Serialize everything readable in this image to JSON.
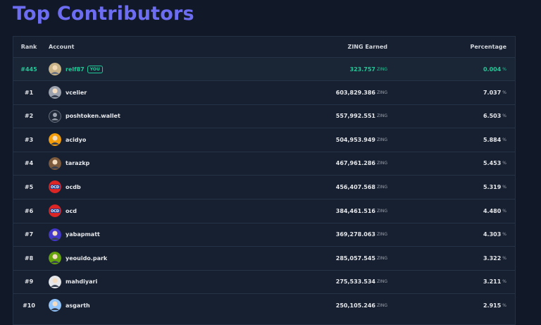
{
  "page": {
    "title": "Top Contributors"
  },
  "table": {
    "headers": {
      "rank": "Rank",
      "account": "Account",
      "zing": "ZING Earned",
      "percentage": "Percentage"
    },
    "unit_label": "ZING",
    "percent_symbol": "%",
    "you_row": {
      "rank": "#445",
      "account": "relf87",
      "badge": "YOU",
      "zing": "323.757",
      "percentage": "0.004",
      "avatar": "user-avatar-icon"
    },
    "rows": [
      {
        "rank": "#1",
        "account": "vcelier",
        "zing": "603,829.386",
        "percentage": "7.037",
        "avatar": "user-avatar-icon"
      },
      {
        "rank": "#2",
        "account": "poshtoken.wallet",
        "zing": "557,992.551",
        "percentage": "6.503",
        "avatar": "default-user-icon"
      },
      {
        "rank": "#3",
        "account": "acidyo",
        "zing": "504,953.949",
        "percentage": "5.884",
        "avatar": "user-avatar-icon"
      },
      {
        "rank": "#4",
        "account": "tarazkp",
        "zing": "467,961.286",
        "percentage": "5.453",
        "avatar": "user-avatar-icon"
      },
      {
        "rank": "#5",
        "account": "ocdb",
        "zing": "456,407.568",
        "percentage": "5.319",
        "avatar": "ocd-logo-icon"
      },
      {
        "rank": "#6",
        "account": "ocd",
        "zing": "384,461.516",
        "percentage": "4.480",
        "avatar": "ocd-logo-icon"
      },
      {
        "rank": "#7",
        "account": "yabapmatt",
        "zing": "369,278.063",
        "percentage": "4.303",
        "avatar": "user-avatar-icon"
      },
      {
        "rank": "#8",
        "account": "yeouido.park",
        "zing": "285,057.545",
        "percentage": "3.322",
        "avatar": "user-avatar-icon"
      },
      {
        "rank": "#9",
        "account": "mahdiyari",
        "zing": "275,533.534",
        "percentage": "3.211",
        "avatar": "user-avatar-icon"
      },
      {
        "rank": "#10",
        "account": "asgarth",
        "zing": "250,105.246",
        "percentage": "2.915",
        "avatar": "user-avatar-icon"
      }
    ]
  },
  "colors": {
    "title": "#6d6df2",
    "highlight": "#20c997",
    "background": "#111827",
    "panel": "#172030"
  }
}
